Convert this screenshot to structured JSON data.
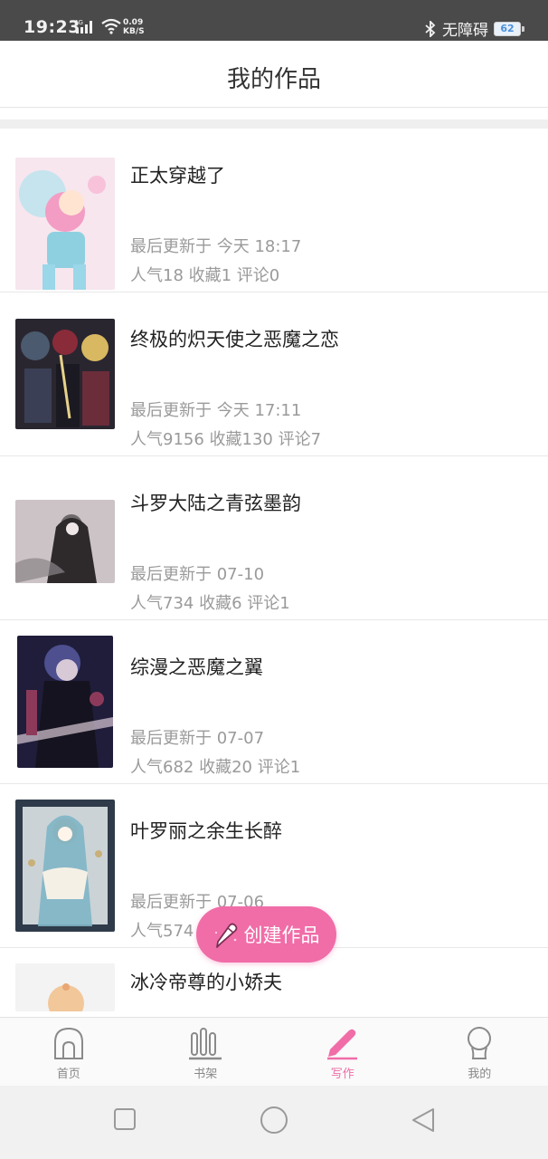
{
  "status_bar": {
    "time": "19:23",
    "network_label": "4G",
    "speed_value": "0.09",
    "speed_unit": "KB/S",
    "accessibility_label": "无障碍",
    "battery_level": "62",
    "icons": [
      "signal-icon",
      "wifi-icon",
      "bluetooth-icon",
      "battery-icon"
    ]
  },
  "header": {
    "title": "我的作品"
  },
  "works": [
    {
      "title": "正太穿越了",
      "updated": "最后更新于 今天 18:17",
      "stats": "人气18  收藏1  评论0",
      "cover_colors": [
        "#f7d7e6",
        "#b8e3ee",
        "#8fd0e0",
        "#f39cc4"
      ]
    },
    {
      "title": "终极的炽天使之恶魔之恋",
      "updated": "最后更新于 今天 17:11",
      "stats": "人气9156  收藏130  评论7",
      "cover_colors": [
        "#2a2630",
        "#8a2b3a",
        "#d8b860",
        "#4b5a6e"
      ]
    },
    {
      "title": "斗罗大陆之青弦墨韵",
      "updated": "最后更新于 07-10",
      "stats": "人气734  收藏6  评论1",
      "cover_colors": [
        "#d9d6d8",
        "#6e6a6c",
        "#2e2a2c",
        "#b9a8ae"
      ]
    },
    {
      "title": "综漫之恶魔之翼",
      "updated": "最后更新于 07-07",
      "stats": "人气682  收藏20  评论1",
      "cover_colors": [
        "#1f1d3a",
        "#4d4f8e",
        "#d8c9d6",
        "#8d3a5a"
      ]
    },
    {
      "title": "叶罗丽之余生长醉",
      "updated": "最后更新于 07-06",
      "stats": "人气574  收藏10  评论1",
      "cover_colors": [
        "#e6eef0",
        "#7fb5c6",
        "#c9b07a",
        "#2f3b4a"
      ]
    },
    {
      "title": "冰冷帝尊的小娇夫",
      "updated": "",
      "stats": "",
      "cover_colors": [
        "#f3f3f3",
        "#f2c79a",
        "#e8a774",
        "#d9d9d9"
      ]
    }
  ],
  "fab": {
    "label": "创建作品",
    "icon": "pencil-icon",
    "color": "#f06da8"
  },
  "bottom_nav": [
    {
      "label": "首页",
      "icon": "home-icon",
      "active": false
    },
    {
      "label": "书架",
      "icon": "bookshelf-icon",
      "active": false
    },
    {
      "label": "写作",
      "icon": "pen-icon",
      "active": true
    },
    {
      "label": "我的",
      "icon": "profile-icon",
      "active": false
    }
  ],
  "system_nav": {
    "icons": [
      "recent-apps-icon",
      "home-circle-icon",
      "back-icon"
    ]
  },
  "colors": {
    "accent": "#f06da8",
    "status_bar": "#4a4a4a",
    "text_primary": "#222222",
    "text_secondary": "#9a9a9a"
  }
}
